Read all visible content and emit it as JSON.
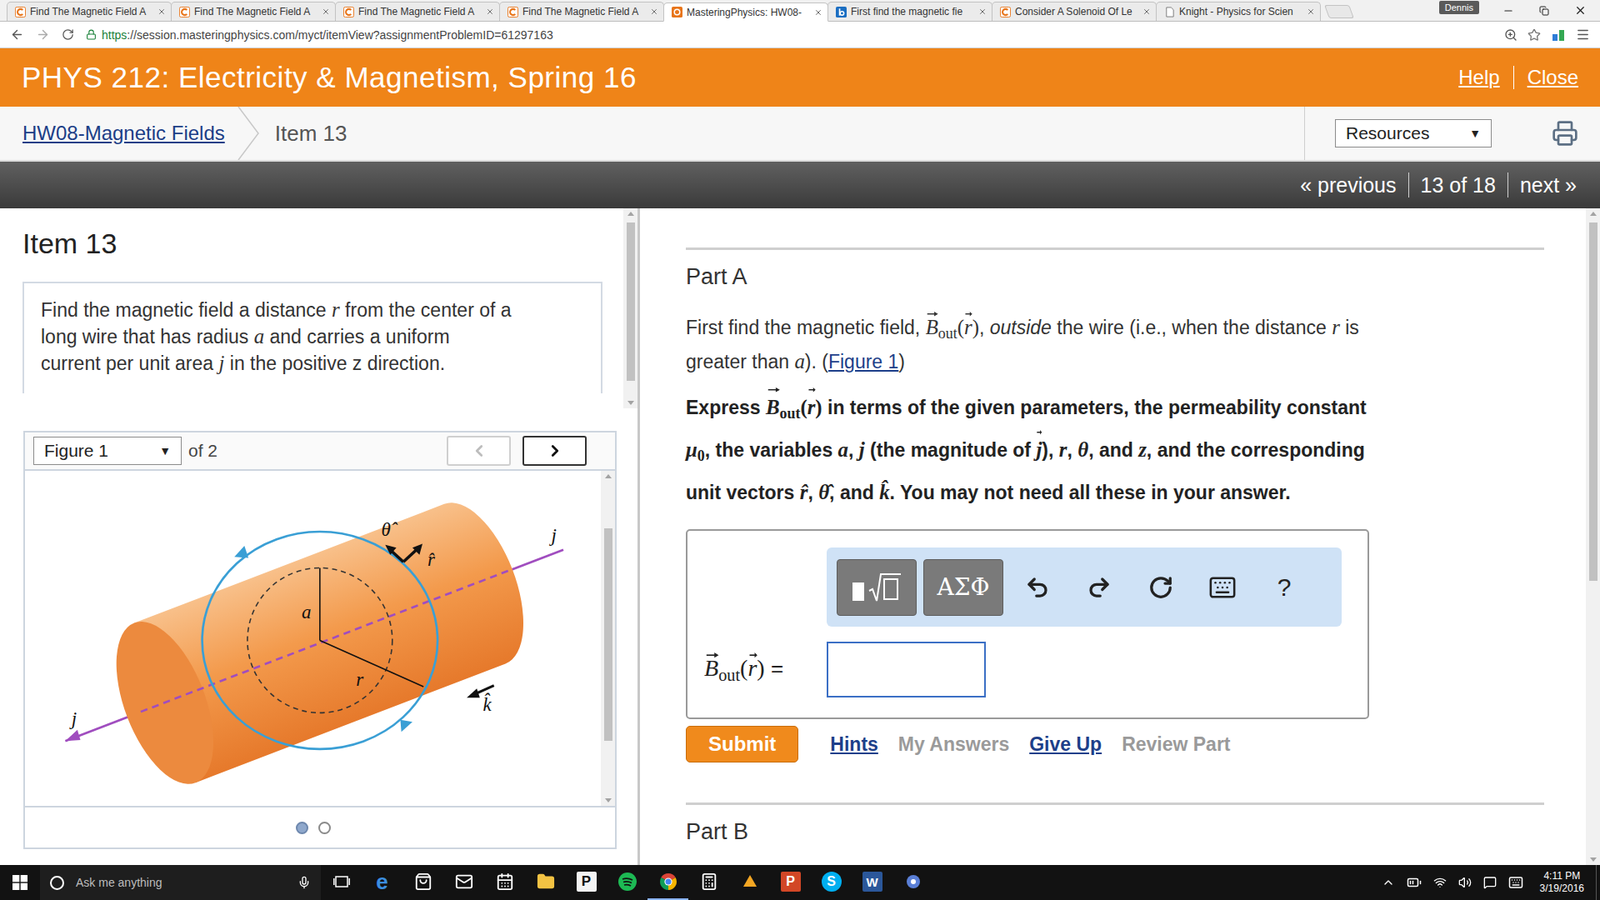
{
  "browser": {
    "tabs": [
      {
        "label": "Find The Magnetic Field A",
        "kind": "chegg",
        "selected": false
      },
      {
        "label": "Find The Magnetic Field A",
        "kind": "chegg",
        "selected": false
      },
      {
        "label": "Find The Magnetic Field A",
        "kind": "chegg",
        "selected": false
      },
      {
        "label": "Find The Magnetic Field A",
        "kind": "chegg",
        "selected": false
      },
      {
        "label": "MasteringPhysics: HW08-",
        "kind": "mastering",
        "selected": true
      },
      {
        "label": "First find the magnetic fie",
        "kind": "bartleby",
        "selected": false
      },
      {
        "label": "Consider A Solenoid Of Le",
        "kind": "chegg",
        "selected": false
      },
      {
        "label": "Knight - Physics for Scien",
        "kind": "page",
        "selected": false
      }
    ],
    "profile": "Dennis",
    "url": {
      "scheme": "https",
      "rest": "://session.masteringphysics.com/myct/itemView?assignmentProblemID=61297163"
    }
  },
  "header": {
    "course": "PHYS 212: Electricity & Magnetism, Spring 16",
    "links": [
      "Help",
      "Close"
    ]
  },
  "breadcrumb": {
    "assignment": "HW08-Magnetic Fields",
    "item": "Item 13",
    "resources": "Resources",
    "caret": "▼"
  },
  "nav": {
    "previous": "« previous",
    "position": "13 of 18",
    "next": "next »"
  },
  "problem": {
    "title": "Item 13",
    "lines": [
      [
        {
          "text": "Find the magnetic field a distance ",
          "kind": "plain"
        },
        {
          "text": "r",
          "kind": "var"
        },
        {
          "text": " from the center of a",
          "kind": "plain"
        }
      ],
      [
        {
          "text": "long wire that has radius ",
          "kind": "plain"
        },
        {
          "text": "a",
          "kind": "var"
        },
        {
          "text": " and carries a uniform",
          "kind": "plain"
        }
      ],
      [
        {
          "text": "current per unit area ",
          "kind": "plain"
        },
        {
          "text": "j",
          "kind": "var"
        },
        {
          "text": " in the positive z direction.",
          "kind": "plain"
        }
      ]
    ]
  },
  "figure": {
    "selector": "Figure 1",
    "caret": "▼",
    "count": "of 2",
    "prev_disabled": true,
    "next_disabled": false,
    "labels": {
      "theta_hat": "θ̂",
      "r_hat": "r̂",
      "a": "a",
      "r": "r",
      "k_hat": "k̂",
      "j_top": "j",
      "j_bottom": "j"
    },
    "dots": [
      {
        "selected": true
      },
      {
        "selected": false
      }
    ]
  },
  "part_a": {
    "title": "Part A",
    "question": [
      [
        {
          "text": "First find the magnetic field, ",
          "kind": "plain"
        },
        {
          "text": "B",
          "kind": "vec"
        },
        {
          "text": "out",
          "kind": "sub"
        },
        {
          "text": "(",
          "kind": "math"
        },
        {
          "text": "r",
          "kind": "vec"
        },
        {
          "text": ")",
          "kind": "math"
        },
        {
          "text": ", ",
          "kind": "plain"
        },
        {
          "text": "outside",
          "kind": "em"
        },
        {
          "text": " the wire (i.e., when the distance ",
          "kind": "plain"
        },
        {
          "text": "r",
          "kind": "var"
        },
        {
          "text": " is",
          "kind": "plain"
        }
      ],
      [
        {
          "text": "greater than ",
          "kind": "plain"
        },
        {
          "text": "a",
          "kind": "var"
        },
        {
          "text": "). (",
          "kind": "plain"
        },
        {
          "text": "Figure 1",
          "kind": "link"
        },
        {
          "text": ")",
          "kind": "plain"
        }
      ]
    ],
    "instruction": [
      [
        {
          "text": "Express ",
          "kind": "plain"
        },
        {
          "text": "B",
          "kind": "vec"
        },
        {
          "text": "out",
          "kind": "sub"
        },
        {
          "text": "(",
          "kind": "math"
        },
        {
          "text": "r",
          "kind": "vec"
        },
        {
          "text": ")",
          "kind": "math"
        },
        {
          "text": " in terms of the given parameters, the permeability constant",
          "kind": "plain"
        }
      ],
      [
        {
          "text": "μ",
          "kind": "var"
        },
        {
          "text": "0",
          "kind": "sub"
        },
        {
          "text": ", the variables ",
          "kind": "plain"
        },
        {
          "text": "a",
          "kind": "var"
        },
        {
          "text": ", ",
          "kind": "plain"
        },
        {
          "text": "j",
          "kind": "var"
        },
        {
          "text": " (the magnitude of ",
          "kind": "plain"
        },
        {
          "text": "j",
          "kind": "vec"
        },
        {
          "text": "), ",
          "kind": "plain"
        },
        {
          "text": "r",
          "kind": "var"
        },
        {
          "text": ", ",
          "kind": "plain"
        },
        {
          "text": "θ",
          "kind": "var"
        },
        {
          "text": ", and ",
          "kind": "plain"
        },
        {
          "text": "z",
          "kind": "var"
        },
        {
          "text": ", and the corresponding",
          "kind": "plain"
        }
      ],
      [
        {
          "text": "unit vectors ",
          "kind": "plain"
        },
        {
          "text": "r̂",
          "kind": "var"
        },
        {
          "text": ", ",
          "kind": "plain"
        },
        {
          "text": "θ̂",
          "kind": "var"
        },
        {
          "text": ", and ",
          "kind": "plain"
        },
        {
          "text": "k̂",
          "kind": "var"
        },
        {
          "text": ". You may not need all these in your answer.",
          "kind": "plain"
        }
      ]
    ],
    "toolbar": {
      "symbols": "ΑΣΦ",
      "help": "?"
    },
    "answer": {
      "label": [
        {
          "text": "B",
          "kind": "vec"
        },
        {
          "text": "out",
          "kind": "sub"
        },
        {
          "text": "(",
          "kind": "math"
        },
        {
          "text": "r",
          "kind": "vec"
        },
        {
          "text": ")",
          "kind": "math"
        },
        {
          "text": " =",
          "kind": "plain"
        }
      ],
      "value": ""
    },
    "submit": "Submit",
    "links": [
      {
        "label": "Hints",
        "disabled": false
      },
      {
        "label": "My Answers",
        "disabled": true
      },
      {
        "label": "Give Up",
        "disabled": false
      },
      {
        "label": "Review Part",
        "disabled": true
      }
    ]
  },
  "part_b": {
    "title": "Part B"
  },
  "taskbar": {
    "search": "Ask me anything",
    "apps": [
      {
        "kind": "edge",
        "glyph": "e",
        "running": false
      },
      {
        "kind": "store",
        "running": false
      },
      {
        "kind": "mail",
        "running": false
      },
      {
        "kind": "calendar",
        "running": false
      },
      {
        "kind": "explorer",
        "running": false
      },
      {
        "kind": "publisher",
        "glyph": "P",
        "running": false
      },
      {
        "kind": "spotify",
        "running": false
      },
      {
        "kind": "chrome",
        "running": true
      },
      {
        "kind": "calculator",
        "running": false
      },
      {
        "kind": "app",
        "running": false
      },
      {
        "kind": "powerpoint",
        "glyph": "P",
        "running": false
      },
      {
        "kind": "skype",
        "glyph": "S",
        "running": false
      },
      {
        "kind": "word",
        "glyph": "W",
        "running": false
      },
      {
        "kind": "other",
        "running": false
      }
    ],
    "time": "4:11 PM",
    "date": "3/19/2016"
  }
}
